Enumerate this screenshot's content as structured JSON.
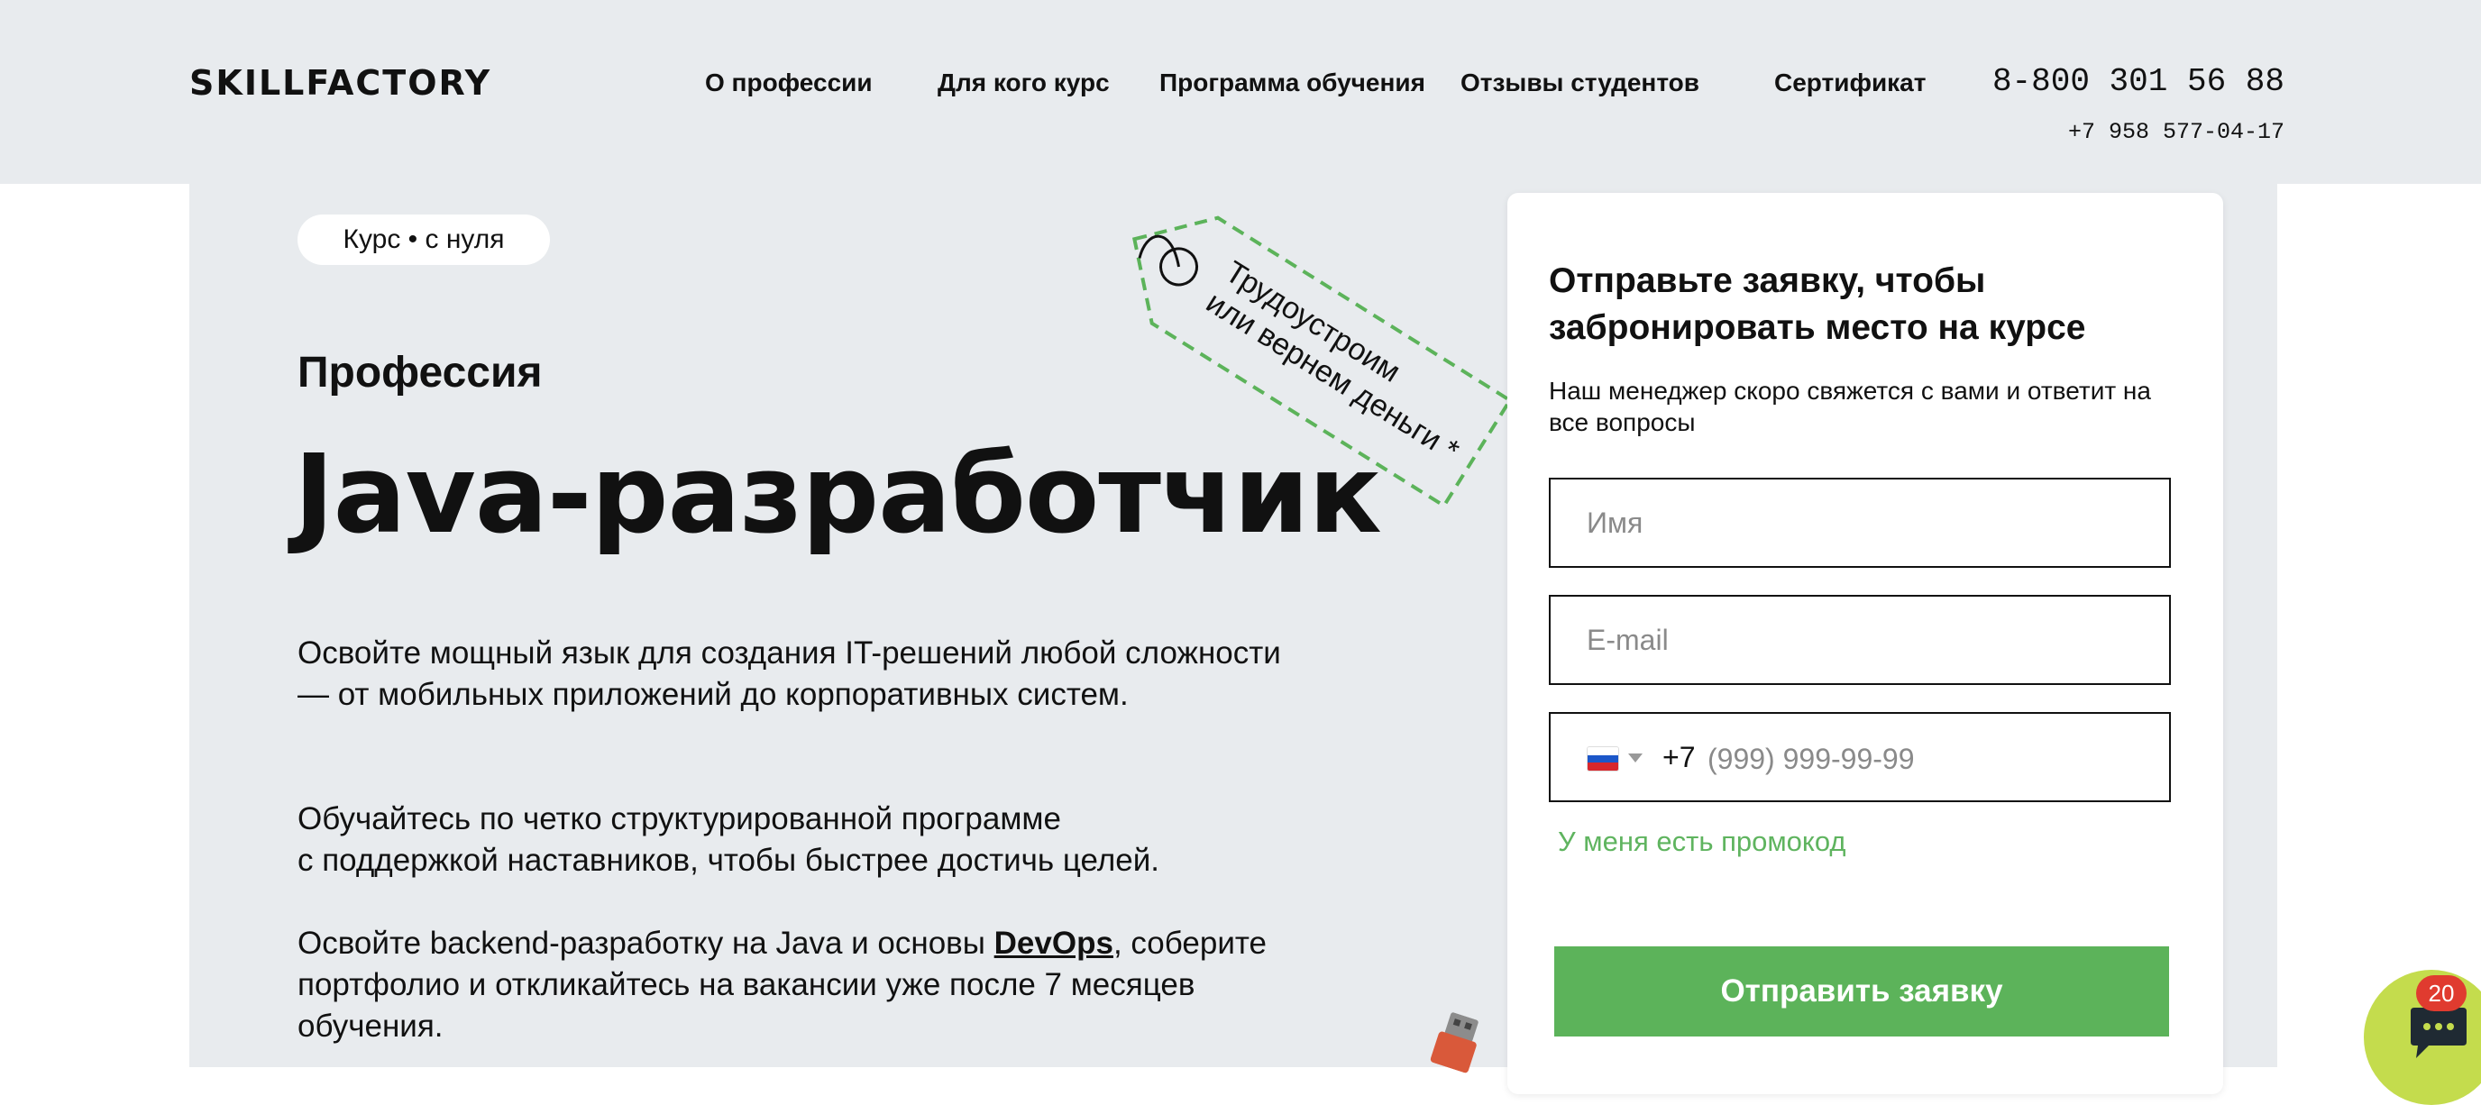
{
  "header": {
    "logo": "SKILLFACTORY",
    "nav": [
      "О профессии",
      "Для кого курс",
      "Программа обучения",
      "Отзывы студентов",
      "Сертификат"
    ],
    "phone_main": "8-800 301 56 88",
    "phone_alt": "+7 958 577-04-17"
  },
  "hero": {
    "badge": "Курс • с нуля",
    "eyebrow": "Профессия",
    "title": "Java-разработчик",
    "paragraph_1": "Освойте мощный язык для создания IT-решений любой сложности — от мобильных приложений до корпоративных систем.",
    "paragraph_2_line1": "Обучайтесь по четко структурированной программе",
    "paragraph_2_line2": "с поддержкой наставников, чтобы быстрее достичь целей.",
    "paragraph_3_before": "Освойте backend-разработку на Java и основы ",
    "paragraph_3_link": "DevOps",
    "paragraph_3_after": ", соберите портфолио и откликайтесь на вакансии уже после 7 месяцев обучения."
  },
  "tag": {
    "line1": "Трудоустроим",
    "line2": "или вернем деньги *"
  },
  "form": {
    "title": "Отправьте заявку, чтобы забронировать место на курсе",
    "subtitle": "Наш менеджер скоро свяжется с вами и ответит на все вопросы",
    "name_placeholder": "Имя",
    "email_placeholder": "E-mail",
    "phone_code": "+7",
    "phone_placeholder": "(999) 999-99-99",
    "promo_link": "У меня есть промокод",
    "submit": "Отправить заявку"
  },
  "chat": {
    "badge_count": "20"
  },
  "colors": {
    "accent_green": "#5cb35a",
    "header_bg": "#e8ebee",
    "chat_bg": "#c4dc4d",
    "badge_red": "#e03b2f"
  }
}
